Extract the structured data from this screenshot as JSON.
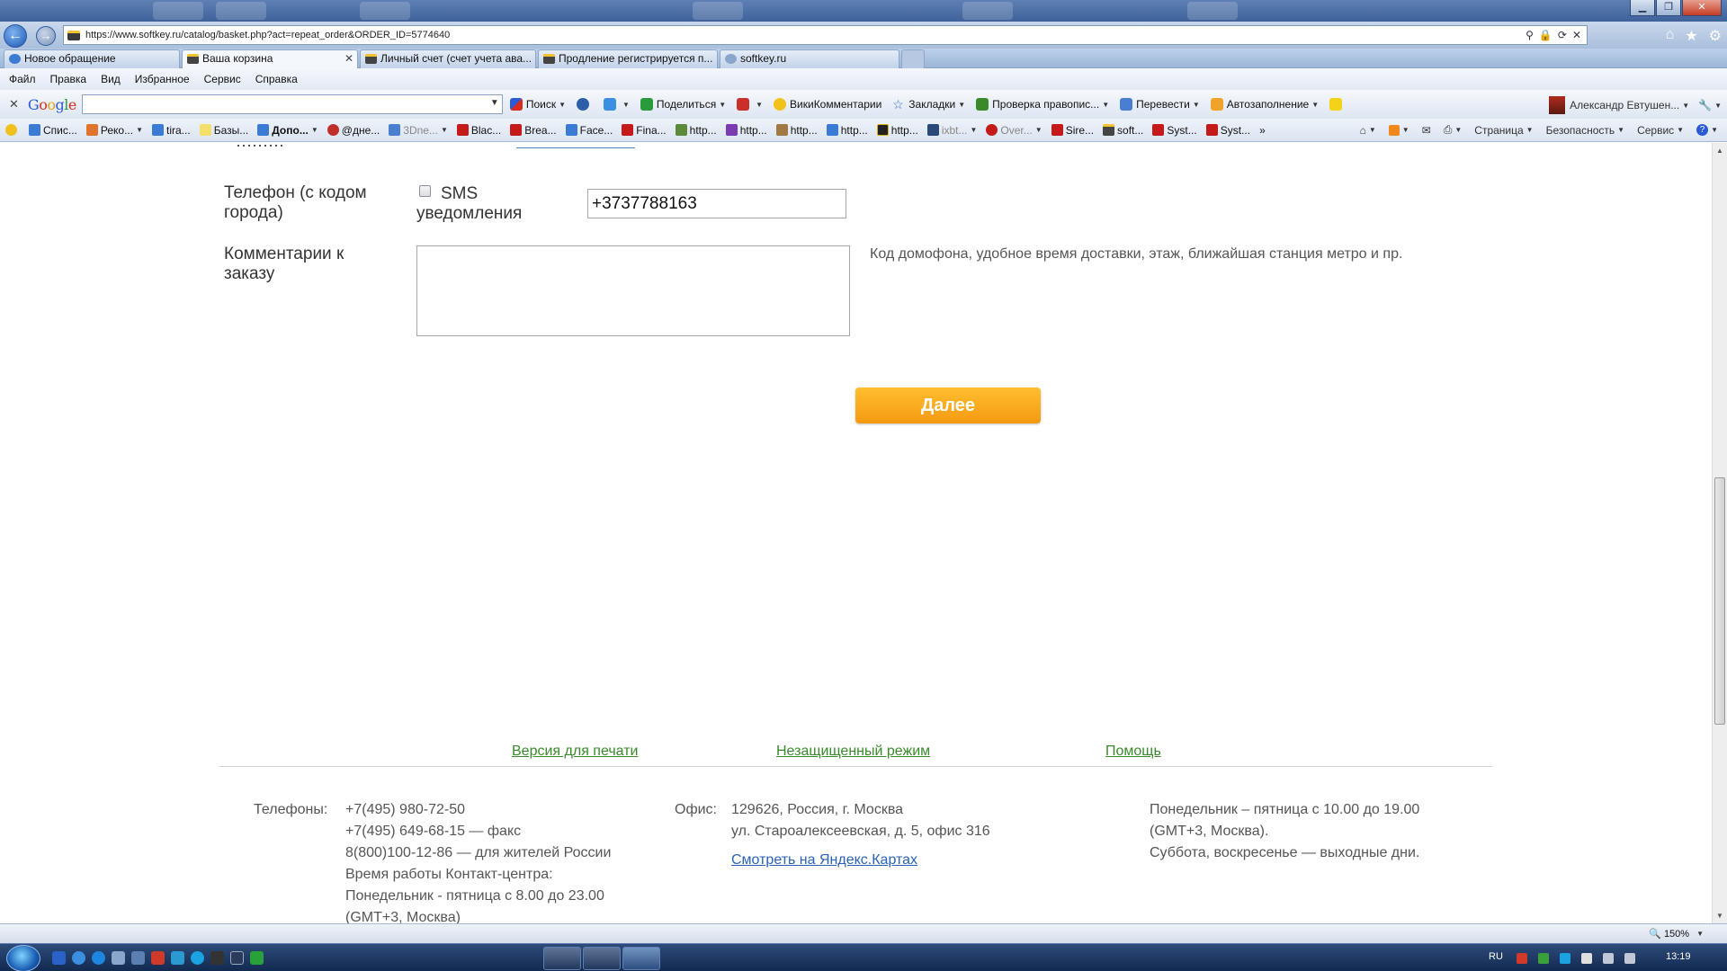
{
  "browser": {
    "url": "https://www.softkey.ru/catalog/basket.php?act=repeat_order&ORDER_ID=5774640",
    "tabs": [
      {
        "label": "Новое обращение"
      },
      {
        "label": "Ваша корзина",
        "close": "✕"
      },
      {
        "label": "Личный счет (счет учета ава..."
      },
      {
        "label": "Продление регистрируется п..."
      },
      {
        "label": "softkey.ru"
      }
    ],
    "menu": [
      "Файл",
      "Правка",
      "Вид",
      "Избранное",
      "Сервис",
      "Справка"
    ],
    "google_toolbar": {
      "logo": "Google",
      "search_value": "",
      "search": "Поиск",
      "share": "Поделиться",
      "wiki": "ВикиКомментарии",
      "bookmarks": "Закладки",
      "spellcheck": "Проверка правопис...",
      "translate": "Перевести",
      "autofill": "Автозаполнение",
      "user": "Александр Евтушен..."
    },
    "favorites": [
      "Спис...",
      "Реко...",
      "tira...",
      "Базы...",
      "Допо...",
      "@дне...",
      "3Dne...",
      "Blac...",
      "Brea...",
      "Face...",
      "Fina...",
      "http...",
      "http...",
      "http...",
      "http...",
      "http...",
      "ixbt...",
      "Over...",
      "Sire...",
      "soft...",
      "Syst...",
      "Syst..."
    ],
    "command_bar": {
      "page": "Страница",
      "safety": "Безопасность",
      "tools": "Сервис"
    },
    "zoom": "150%"
  },
  "form": {
    "phone_label": "Телефон (с кодом города)",
    "sms_label": "SMS уведомления",
    "sms_checked": false,
    "phone_value": "+3737788163",
    "comments_label": "Комментарии к заказу",
    "comments_value": "",
    "comments_hint": "Код домофона, удобное время доставки, этаж, ближайшая станция метро и пр.",
    "next_button": "Далее"
  },
  "footer": {
    "links": [
      "Версия для печати",
      "Незащищенный режим",
      "Помощь"
    ],
    "phones_label": "Телефоны:",
    "phones": [
      "+7(495) 980-72-50",
      "+7(495) 649-68-15 — факс",
      "8(800)100-12-86 — для жителей России",
      "Время работы Контакт-центра:",
      "Понедельник - пятница с 8.00 до 23.00",
      "(GMT+3, Москва)"
    ],
    "office_label": "Офис:",
    "office_lines": [
      "129626, Россия, г. Москва",
      "ул. Староалексеевская, д. 5, офис 316"
    ],
    "maps_link": "Смотреть на Яндекс.Картах",
    "hours_lines": [
      "Понедельник – пятница с 10.00 до 19.00",
      "(GMT+3, Москва).",
      "Суббота, воскресенье — выходные дни."
    ]
  },
  "taskbar": {
    "language": "RU",
    "clock": "13:19"
  },
  "colors": {
    "button_orange": "#f7a51c",
    "footer_link_green": "#3a8a2c",
    "maps_link_blue": "#2a62b7"
  }
}
